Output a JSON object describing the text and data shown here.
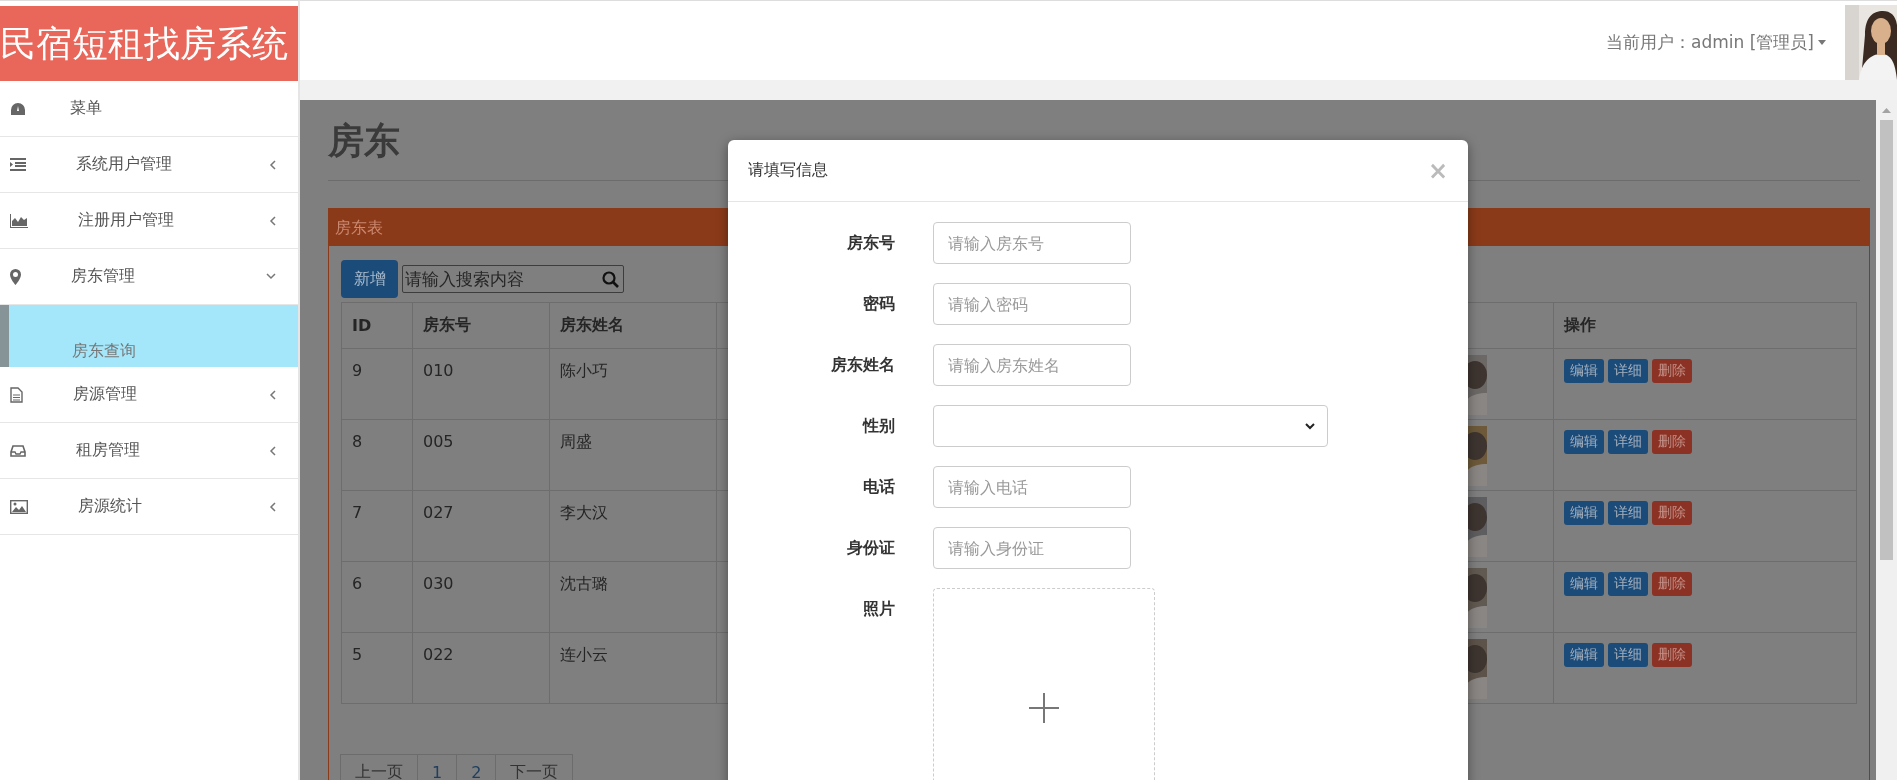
{
  "app": {
    "title": "民宿短租找房系统"
  },
  "header": {
    "user_label": "当前用户：admin [管理员]"
  },
  "sidebar": {
    "items": [
      {
        "label": "菜单",
        "kind": "heading"
      },
      {
        "label": "系统用户管理",
        "kind": "group",
        "expanded": false
      },
      {
        "label": "注册用户管理",
        "kind": "group",
        "expanded": false
      },
      {
        "label": "房东管理",
        "kind": "group",
        "expanded": true,
        "children": [
          {
            "label": "房东查询",
            "selected": true
          }
        ]
      },
      {
        "label": "房源管理",
        "kind": "group",
        "expanded": false
      },
      {
        "label": "租房管理",
        "kind": "group",
        "expanded": false
      },
      {
        "label": "房源统计",
        "kind": "group",
        "expanded": false
      }
    ]
  },
  "page": {
    "title": "房东",
    "panel_title": "房东表",
    "add_button": "新增",
    "search": {
      "placeholder": "请输入搜索内容"
    },
    "table": {
      "columns": [
        "ID",
        "房东号",
        "房东姓名",
        "操作"
      ],
      "rows": [
        {
          "id": "9",
          "number": "010",
          "name": "陈小巧",
          "photo": {
            "kind": "picture"
          },
          "actions": [
            "编辑",
            "详细",
            "删除"
          ]
        },
        {
          "id": "8",
          "number": "005",
          "name": "周盛",
          "photo": {
            "kind": "picture"
          },
          "actions": [
            "编辑",
            "详细",
            "删除"
          ]
        },
        {
          "id": "7",
          "number": "027",
          "name": "李大汉",
          "photo": {
            "kind": "picture"
          },
          "actions": [
            "编辑",
            "详细",
            "删除"
          ]
        },
        {
          "id": "6",
          "number": "030",
          "name": "沈古璐",
          "photo": {
            "kind": "picture"
          },
          "actions": [
            "编辑",
            "详细",
            "删除"
          ]
        },
        {
          "id": "5",
          "number": "022",
          "name": "连小云",
          "photo": {
            "kind": "picture"
          },
          "actions": [
            "编辑",
            "详细",
            "删除"
          ]
        }
      ]
    },
    "pagination": [
      "上一页",
      "1",
      "2",
      "下一页"
    ]
  },
  "modal": {
    "title": "请填写信息",
    "close": "×",
    "fields": [
      {
        "label": "房东号",
        "kind": "text",
        "placeholder": "请输入房东号"
      },
      {
        "label": "密码",
        "kind": "text",
        "placeholder": "请输入密码"
      },
      {
        "label": "房东姓名",
        "kind": "text",
        "placeholder": "请输入房东姓名"
      },
      {
        "label": "性别",
        "kind": "select"
      },
      {
        "label": "电话",
        "kind": "text",
        "placeholder": "请输入电话"
      },
      {
        "label": "身份证",
        "kind": "text",
        "placeholder": "请输入身份证"
      },
      {
        "label": "照片",
        "kind": "upload"
      }
    ]
  }
}
